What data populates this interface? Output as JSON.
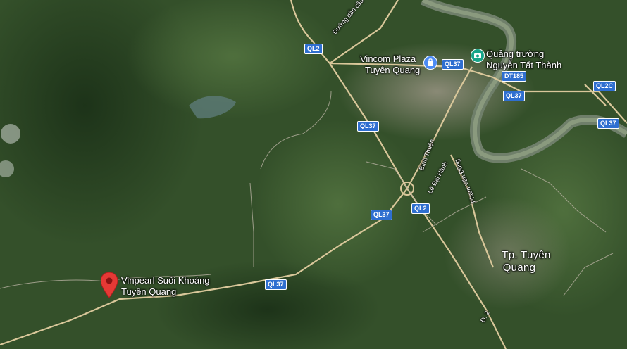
{
  "map": {
    "places": {
      "vinpearl": [
        "Vinpearl Suối Khoáng",
        "Tuyên Quang"
      ],
      "vincom": [
        "Vincom Plaza",
        "Tuyên Quang"
      ],
      "square": [
        "Quảng trường",
        "Nguyễn Tất Thành"
      ],
      "city": [
        "Tp. Tuyên",
        "Quang"
      ]
    },
    "roads": {
      "ql2_a": "QL2",
      "ql2_b": "QL2",
      "ql37_a": "QL37",
      "ql37_b": "QL37",
      "ql37_c": "QL37",
      "ql37_d": "QL37",
      "ql37_e": "QL37",
      "ql37_f": "QL37",
      "dt185": "DT185",
      "ql2c": "QL2C"
    },
    "streets": {
      "tan_ha": "Đường dẫn cầu Tân Hà",
      "binh_thuan": "Bình Thuận",
      "la_dai_hanh": "Lê Đại Hành",
      "pham_van_dong": "Phạm Văn Đồng",
      "d2": "Đ. 2"
    },
    "icons": {
      "marker": "red-location-pin-icon",
      "shop": "shopping-bag-icon",
      "photo": "camera-icon"
    },
    "colors": {
      "pin": "#e53935",
      "shield": "#2f6fd0",
      "shop": "#4c8bf5",
      "photo": "#17a589"
    }
  }
}
